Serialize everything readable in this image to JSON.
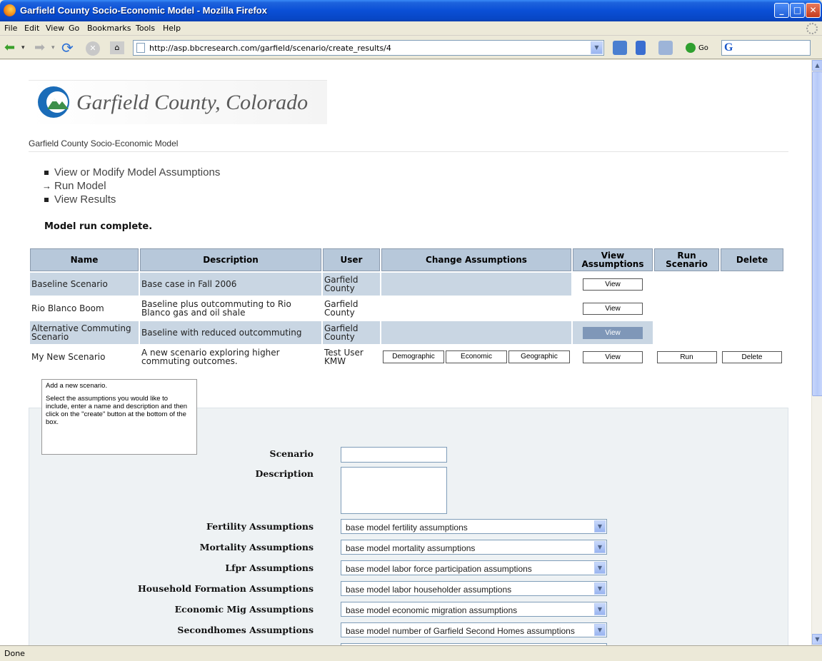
{
  "window": {
    "title": "Garfield County Socio-Economic Model - Mozilla Firefox"
  },
  "menu": [
    "File",
    "Edit",
    "View",
    "Go",
    "Bookmarks",
    "Tools",
    "Help"
  ],
  "nav": {
    "url": "http://asp.bbcresearch.com/garfield/scenario/create_results/4",
    "go_label": "Go"
  },
  "status": "Done",
  "page": {
    "logo_text": "Garfield County, Colorado",
    "site_name": "Garfield County Socio-Economic Model",
    "steps": [
      {
        "label": "View or Modify Model Assumptions",
        "marker": "bullet"
      },
      {
        "label": "Run Model",
        "marker": "arrow"
      },
      {
        "label": "View Results",
        "marker": "bullet"
      }
    ],
    "message": "Model run complete.",
    "table": {
      "headers": [
        "Name",
        "Description",
        "User",
        "Change Assumptions",
        "View Assumptions",
        "Run Scenario",
        "Delete"
      ],
      "rows": [
        {
          "name": "Baseline Scenario",
          "description": "Base case in Fall 2006",
          "user": "Garfield County",
          "view": "View"
        },
        {
          "name": "Rio Blanco Boom",
          "description": "Baseline plus outcommuting to Rio Blanco gas and oil shale",
          "user": "Garfield County",
          "view": "View"
        },
        {
          "name": "Alternative Commuting Scenario",
          "description": "Baseline with reduced outcommuting",
          "user": "Garfield County",
          "view": "View"
        },
        {
          "name": "My New Scenario",
          "description": "A new scenario exploring higher commuting outcomes.",
          "user": "Test User KMW",
          "demographic": "Demographic",
          "economic": "Economic",
          "geographic": "Geographic",
          "view": "View",
          "run": "Run",
          "delete": "Delete"
        }
      ]
    },
    "tooltip": {
      "line1": "Add a new scenario.",
      "line2": "Select the assumptions you would like to include, enter a name and description and then click on the \"create\" button at the bottom of the box."
    },
    "form": {
      "scenario_label": "Scenario",
      "scenario_value": "",
      "description_label": "Description",
      "description_value": "",
      "selects": [
        {
          "label": "Fertility Assumptions",
          "value": "base model fertility assumptions"
        },
        {
          "label": "Mortality Assumptions",
          "value": "base model mortality assumptions"
        },
        {
          "label": "Lfpr Assumptions",
          "value": "base model labor force participation assumptions"
        },
        {
          "label": "Household Formation Assumptions",
          "value": "base model labor householder assumptions"
        },
        {
          "label": "Economic Mig Assumptions",
          "value": "base model economic migration assumptions"
        },
        {
          "label": "Secondhomes Assumptions",
          "value": "base model number of Garfield Second Homes assumptions"
        }
      ]
    }
  },
  "colors": {
    "header_cell": "#b7c8da",
    "shaded_row": "#c9d6e3",
    "form_bg": "#eef2f4",
    "titlebar": "#0a4fd6"
  }
}
